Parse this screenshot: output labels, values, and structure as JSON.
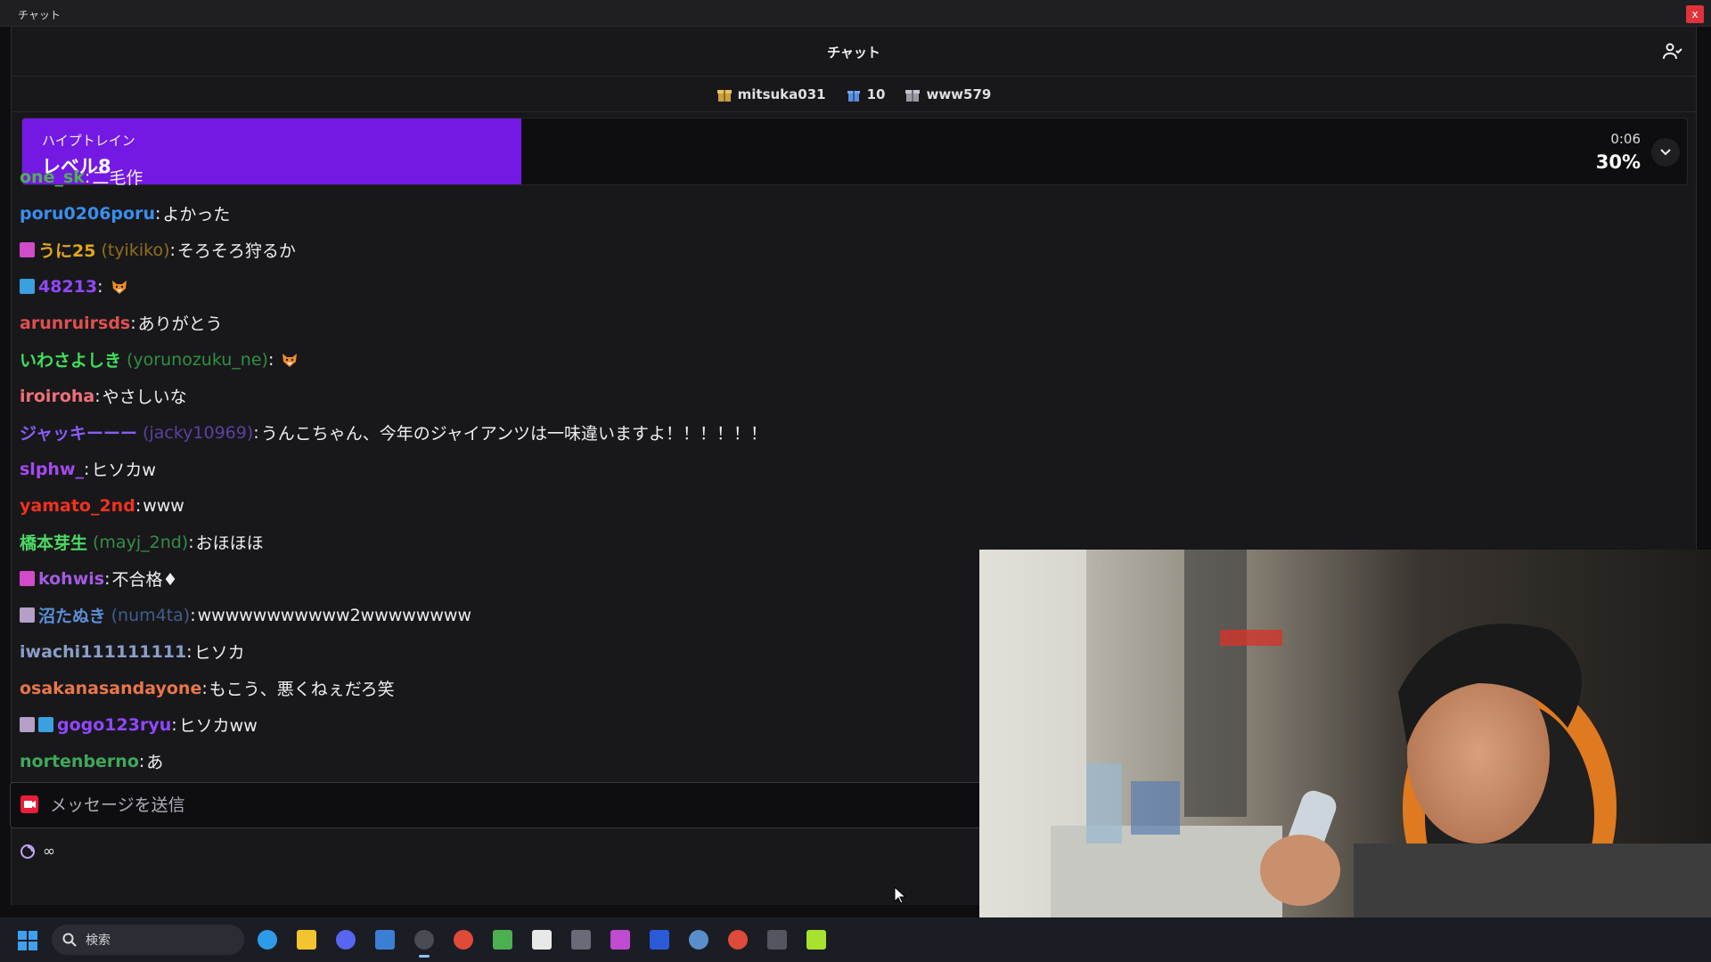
{
  "titlebar": {
    "title": "チャット",
    "close": "x"
  },
  "header": {
    "title": "チャット"
  },
  "gifts": [
    {
      "label": "mitsuka031"
    },
    {
      "label": "10"
    },
    {
      "label": "www579"
    }
  ],
  "hypetrain": {
    "label": "ハイプトレイン",
    "level": "レベル8",
    "timer": "0:06",
    "percent_text": "30%",
    "fill_percent": 30,
    "fill_color": "#7419e3"
  },
  "messages": [
    {
      "badges": [],
      "user": "one_sk",
      "login": "",
      "color": "#4fb04f",
      "text": "二毛作",
      "emote": ""
    },
    {
      "badges": [],
      "user": "poru0206poru",
      "login": "",
      "color": "#3a8eed",
      "text": "よかった",
      "emote": ""
    },
    {
      "badges": [
        "#d04cc8"
      ],
      "user": "うに25",
      "login": "(tyikiko)",
      "color": "#e0a81e",
      "text": "そろそろ狩るか",
      "emote": ""
    },
    {
      "badges": [
        "#3aa0e0"
      ],
      "user": "48213",
      "login": "",
      "color": "#9147ff",
      "text": "",
      "emote": "fox-emote"
    },
    {
      "badges": [],
      "user": "arunruirsds",
      "login": "",
      "color": "#e05050",
      "text": "ありがとう",
      "emote": ""
    },
    {
      "badges": [],
      "user": "いわさよしき",
      "login": "(yorunozuku_ne)",
      "color": "#3ee05a",
      "text": "",
      "emote": "fox-emote"
    },
    {
      "badges": [],
      "user": "iroiroha",
      "login": "",
      "color": "#f0707a",
      "text": "やさしいな",
      "emote": ""
    },
    {
      "badges": [],
      "user": "ジャッキーーー",
      "login": "(jacky10969)",
      "color": "#8a5cf6",
      "text": "うんこちゃん、今年のジャイアンツは一味違いますよ！！！！！！",
      "emote": ""
    },
    {
      "badges": [],
      "user": "slphw_",
      "login": "",
      "color": "#a44af0",
      "text": "ヒソカw",
      "emote": ""
    },
    {
      "badges": [],
      "user": "yamato_2nd",
      "login": "",
      "color": "#f0321e",
      "text": "www",
      "emote": ""
    },
    {
      "badges": [],
      "user": "橋本芽生",
      "login": "(mayj_2nd)",
      "color": "#4cd964",
      "text": "おほほほ",
      "emote": ""
    },
    {
      "badges": [
        "#d04cc8"
      ],
      "user": "kohwis",
      "login": "",
      "color": "#a35ae0",
      "text": "不合格♦",
      "emote": ""
    },
    {
      "badges": [
        "#b5a0c8"
      ],
      "user": "沼たぬき",
      "login": "(num4ta)",
      "color": "#5a8fd6",
      "text": "wwwwwwwwwww2wwwwwwww",
      "emote": ""
    },
    {
      "badges": [],
      "user": "iwachi111111111",
      "login": "",
      "color": "#8a9ec8",
      "text": "ヒソカ",
      "emote": ""
    },
    {
      "badges": [],
      "user": "osakanasandayone",
      "login": "",
      "color": "#e8764a",
      "text": "もこう、悪くねぇだろ笑",
      "emote": ""
    },
    {
      "badges": [
        "#b5a0c8",
        "#3aa0e0"
      ],
      "user": "gogo123ryu",
      "login": "",
      "color": "#9147ff",
      "text": "ヒソカww",
      "emote": ""
    },
    {
      "badges": [],
      "user": "nortenberno",
      "login": "",
      "color": "#3fa95a",
      "text": "あ",
      "emote": ""
    }
  ],
  "input": {
    "placeholder": "メッセージを送信"
  },
  "bottom": {
    "points": "∞"
  },
  "taskbar": {
    "search_placeholder": "検索",
    "apps": [
      "edge-icon",
      "file-explorer-icon",
      "discord-icon",
      "notepad-icon",
      "obs-icon",
      "chrome-icon",
      "minecraft-icon",
      "capcut-icon",
      "keyboard-icon",
      "davinci-icon",
      "display-icon",
      "steam-icon",
      "chrome-icon",
      "unc-icon",
      "streamer-icon"
    ]
  }
}
